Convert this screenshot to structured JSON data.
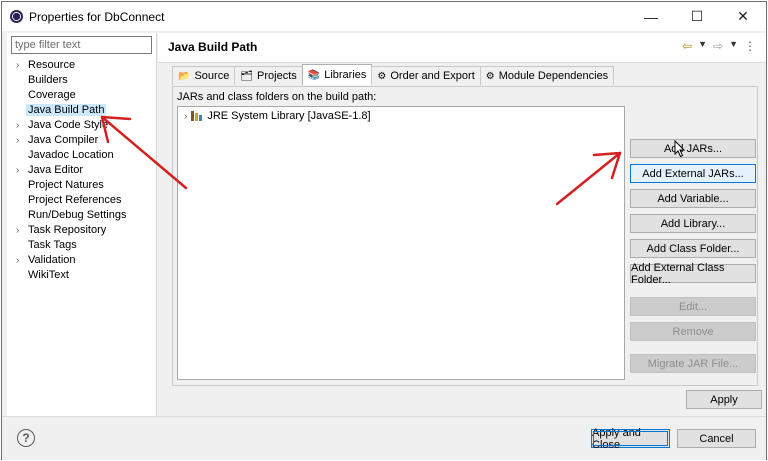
{
  "window": {
    "title": "Properties for DbConnect",
    "controls": {
      "minimize": "—",
      "maximize": "☐",
      "close": "✕"
    }
  },
  "sidebar": {
    "filter_placeholder": "type filter text",
    "items": [
      {
        "label": "Resource",
        "expandable": true
      },
      {
        "label": "Builders",
        "expandable": false
      },
      {
        "label": "Coverage",
        "expandable": false
      },
      {
        "label": "Java Build Path",
        "expandable": false,
        "selected": true
      },
      {
        "label": "Java Code Style",
        "expandable": true
      },
      {
        "label": "Java Compiler",
        "expandable": true
      },
      {
        "label": "Javadoc Location",
        "expandable": false
      },
      {
        "label": "Java Editor",
        "expandable": true
      },
      {
        "label": "Project Natures",
        "expandable": false
      },
      {
        "label": "Project References",
        "expandable": false
      },
      {
        "label": "Run/Debug Settings",
        "expandable": false
      },
      {
        "label": "Task Repository",
        "expandable": true
      },
      {
        "label": "Task Tags",
        "expandable": false
      },
      {
        "label": "Validation",
        "expandable": true
      },
      {
        "label": "WikiText",
        "expandable": false
      }
    ]
  },
  "page": {
    "title": "Java Build Path",
    "tabs": [
      {
        "label": "Source",
        "icon": "source-folder-icon"
      },
      {
        "label": "Projects",
        "icon": "projects-icon"
      },
      {
        "label": "Libraries",
        "icon": "libraries-icon",
        "active": true
      },
      {
        "label": "Order and Export",
        "icon": "order-export-icon"
      },
      {
        "label": "Module Dependencies",
        "icon": "module-icon"
      }
    ],
    "libraries_description": "JARs and class folders on the build path:",
    "library_entries": [
      {
        "label": "JRE System Library [JavaSE-1.8]"
      }
    ],
    "buttons": {
      "add_jars": "Add JARs...",
      "add_external_jars": "Add External JARs...",
      "add_variable": "Add Variable...",
      "add_library": "Add Library...",
      "add_class_folder": "Add Class Folder...",
      "add_external_class_folder": "Add External Class Folder...",
      "edit": "Edit...",
      "remove": "Remove",
      "migrate_jar": "Migrate JAR File..."
    },
    "apply": "Apply"
  },
  "footer": {
    "help": "?",
    "apply_and_close": "Apply and Close",
    "cancel": "Cancel"
  },
  "colors": {
    "selection": "#cce8ff",
    "annotation_arrow": "#d42020",
    "default_button_border": "#0078d7"
  }
}
